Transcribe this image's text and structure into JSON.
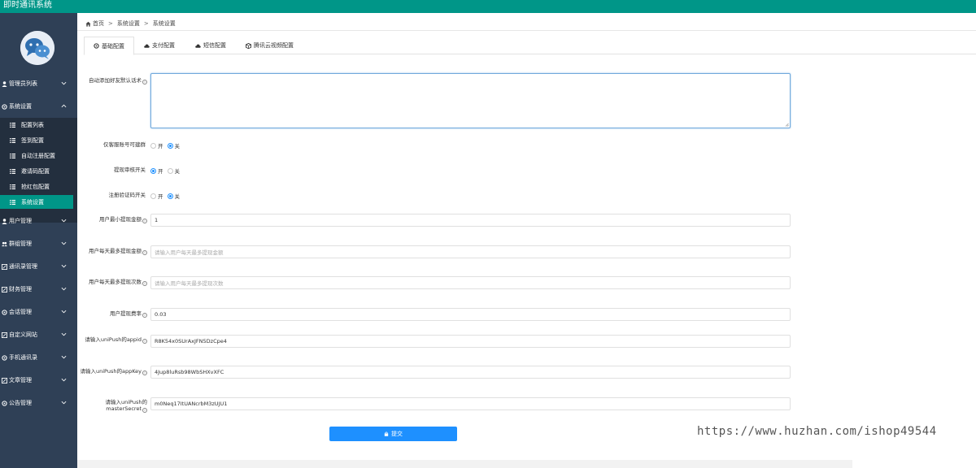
{
  "app": {
    "title": "即时通讯系统"
  },
  "colors": {
    "topbar": "#009688",
    "sidebar": "#2f4056",
    "submenu": "#232f3e",
    "active": "#009688",
    "primary": "#1e90ff"
  },
  "sidebar": {
    "logo_icon": "chat-bubbles-icon",
    "items": [
      {
        "label": "管理员列表",
        "icon": "user-icon"
      },
      {
        "label": "系统设置",
        "icon": "gear-icon"
      },
      {
        "label": "用户管理",
        "icon": "user-icon"
      },
      {
        "label": "群组管理",
        "icon": "group-icon"
      },
      {
        "label": "通讯录管理",
        "icon": "edit-icon"
      },
      {
        "label": "财务管理",
        "icon": "edit-icon"
      },
      {
        "label": "会话管理",
        "icon": "gear-icon"
      },
      {
        "label": "自定义网站",
        "icon": "edit-icon"
      },
      {
        "label": "手机通讯录",
        "icon": "gear-icon"
      },
      {
        "label": "文章管理",
        "icon": "edit-icon"
      },
      {
        "label": "公告管理",
        "icon": "gear-icon"
      }
    ],
    "subitems": [
      {
        "label": "配置列表"
      },
      {
        "label": "签到配置"
      },
      {
        "label": "自动注册配置"
      },
      {
        "label": "邀请码配置"
      },
      {
        "label": "抢红包配置"
      },
      {
        "label": "系统设置"
      }
    ]
  },
  "breadcrumb": {
    "home": "首页",
    "sep": ">",
    "level1": "系统设置",
    "level2": "系统设置"
  },
  "tabs": [
    {
      "label": "基础配置",
      "icon": "gear-icon"
    },
    {
      "label": "支付配置",
      "icon": "cloud-icon"
    },
    {
      "label": "短信配置",
      "icon": "cloud-icon"
    },
    {
      "label": "腾讯云视频配置",
      "icon": "cube-icon"
    }
  ],
  "form": {
    "auto_friend_label": "自动添加好友默认话术",
    "auto_friend_value": "",
    "service_group_label": "仅客服账号可建群",
    "withdraw_audit_label": "提现审核开关",
    "register_code_label": "注册验证码开关",
    "on": "开",
    "off": "关",
    "service_group_value": "关",
    "withdraw_audit_value": "开",
    "register_code_value": "关",
    "min_withdraw_label": "用户最小提现金额",
    "min_withdraw_value": "1",
    "max_withdraw_amount_label": "用户每天最多提现金额",
    "max_withdraw_amount_placeholder": "请输入用户每天最多提现金额",
    "max_withdraw_times_label": "用户每天最多提现次数",
    "max_withdraw_times_placeholder": "请输入用户每天最多提现次数",
    "withdraw_rate_label": "用户提现费率",
    "withdraw_rate_value": "0.03",
    "unipush_appid_label": "请输入uniPush的appid",
    "unipush_appid_value": "R8K54x0SUrAxJFN5DzCpe4",
    "unipush_appkey_label": "请输入uniPush的appKey",
    "unipush_appkey_value": "4Jup8luRsb98WbSHXvXFC",
    "unipush_secret_label": "请输入uniPush的masterSecret",
    "unipush_secret_value": "m0Neq17ItUANcrbM3zUJU1",
    "submit_label": "提交"
  },
  "watermark": "https://www.huzhan.com/ishop49544"
}
